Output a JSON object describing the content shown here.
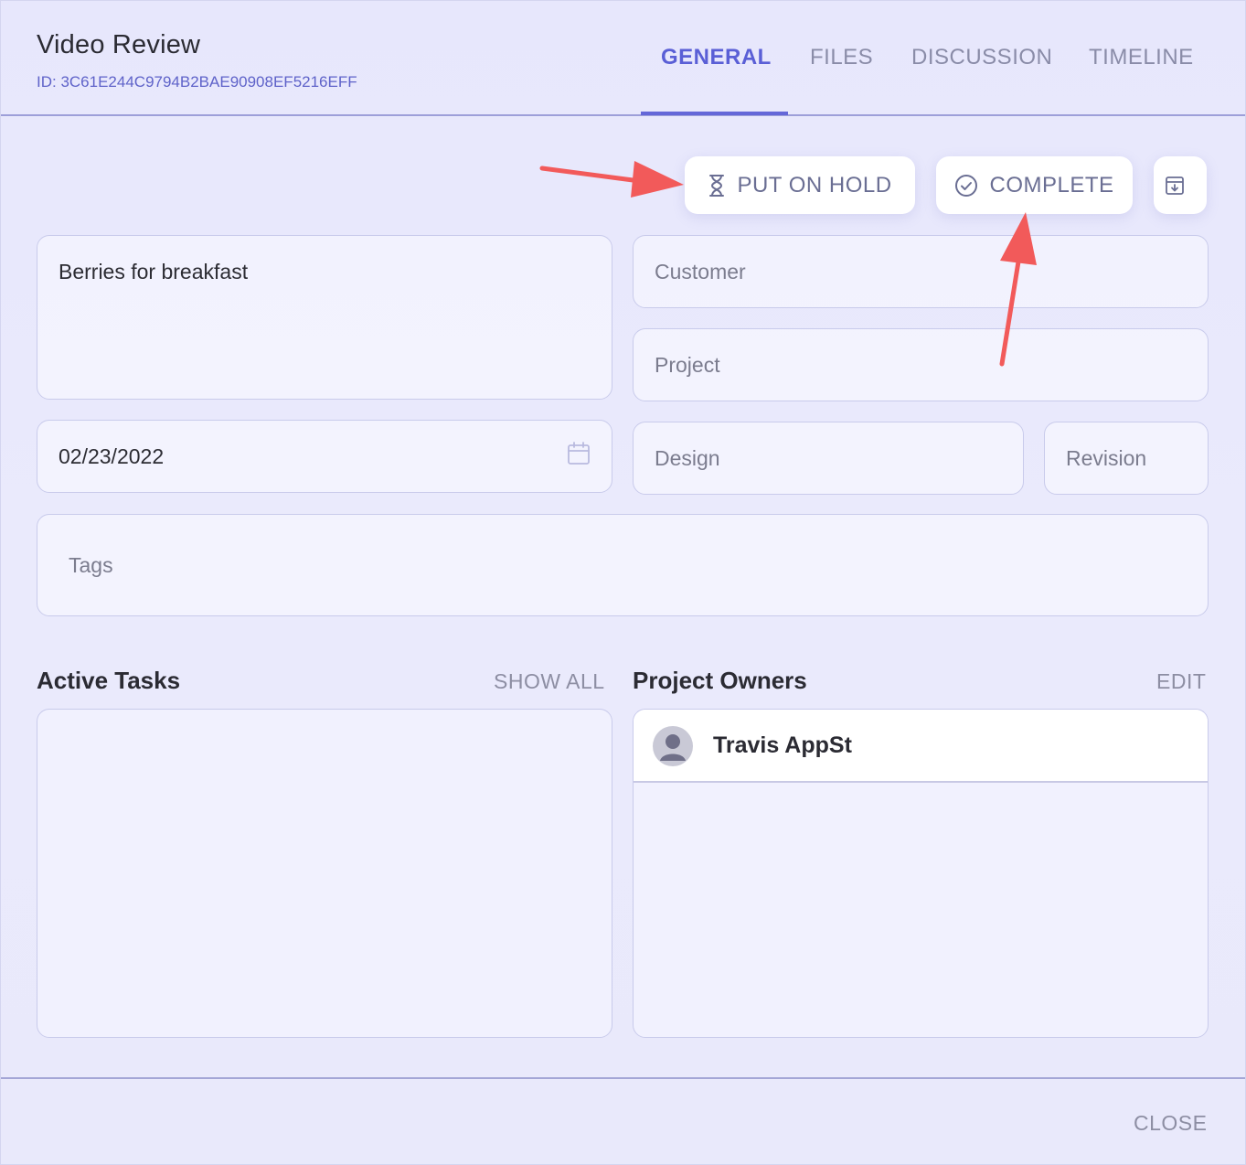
{
  "header": {
    "title": "Video Review",
    "id_text": "ID: 3C61E244C9794B2BAE90908EF5216EFF",
    "tabs": [
      {
        "label": "GENERAL",
        "active": true
      },
      {
        "label": "FILES",
        "active": false
      },
      {
        "label": "DISCUSSION",
        "active": false
      },
      {
        "label": "TIMELINE",
        "active": false
      }
    ]
  },
  "actions": {
    "hold_label": "PUT ON HOLD",
    "complete_label": "COMPLETE",
    "archive_icon": "archive-icon"
  },
  "form": {
    "name_value": "Berries for breakfast",
    "customer_placeholder": "Customer",
    "project_placeholder": "Project",
    "date_value": "02/23/2022",
    "design_placeholder": "Design",
    "revision_placeholder": "Revision",
    "tags_placeholder": "Tags"
  },
  "active_tasks": {
    "title": "Active Tasks",
    "link": "SHOW ALL"
  },
  "project_owners": {
    "title": "Project Owners",
    "link": "EDIT",
    "owners": [
      {
        "name": "Travis AppSt"
      }
    ]
  },
  "footer": {
    "close_label": "CLOSE"
  },
  "colors": {
    "accent": "#5a5fd6",
    "annotation_arrow": "#f25a5a"
  }
}
